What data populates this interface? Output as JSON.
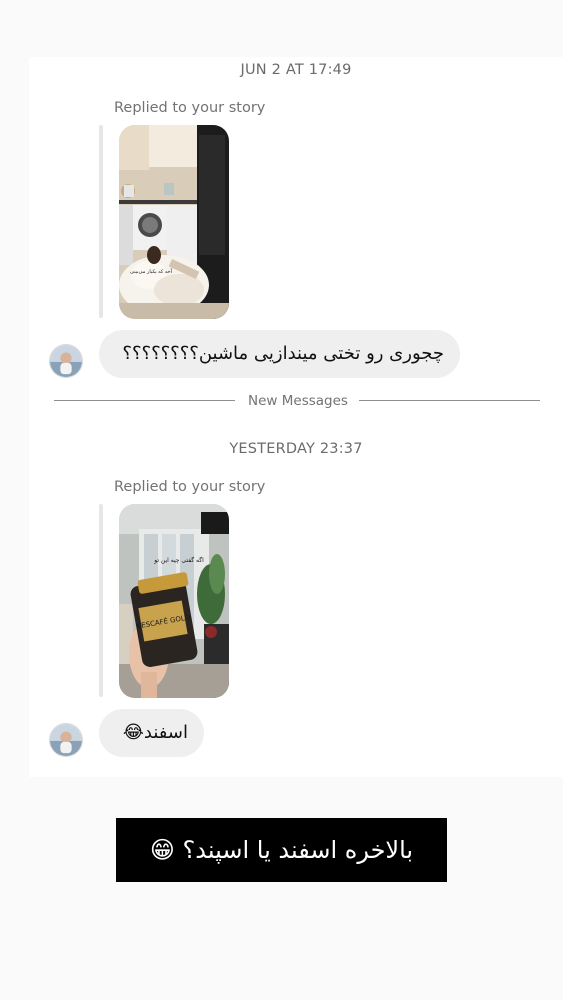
{
  "thread": {
    "first_timestamp": "JUN 2 AT 17:49",
    "first_reply_label": "Replied to your story",
    "first_message": "چجوری رو تختی میندازیی ماشین؟؟؟؟؟؟؟؟",
    "first_story_overlay_text": "آخه که یکبار می‌بینی",
    "divider_label": "New Messages",
    "second_timestamp": "YESTERDAY 23:37",
    "second_reply_label": "Replied to your story",
    "second_message": "اسفند😂",
    "second_story_overlay_text": "اگه گفتی چیه این تو",
    "second_story_jar_label": "NESCAFÉ GOLD"
  },
  "caption": {
    "text": "بالاخره اسفند یا اسپند؟ 😁"
  },
  "colors": {
    "page_bg": "#fafafa",
    "card_bg": "#ffffff",
    "bubble_bg": "#efefef",
    "muted_text": "#737373",
    "caption_bg": "#000000"
  }
}
